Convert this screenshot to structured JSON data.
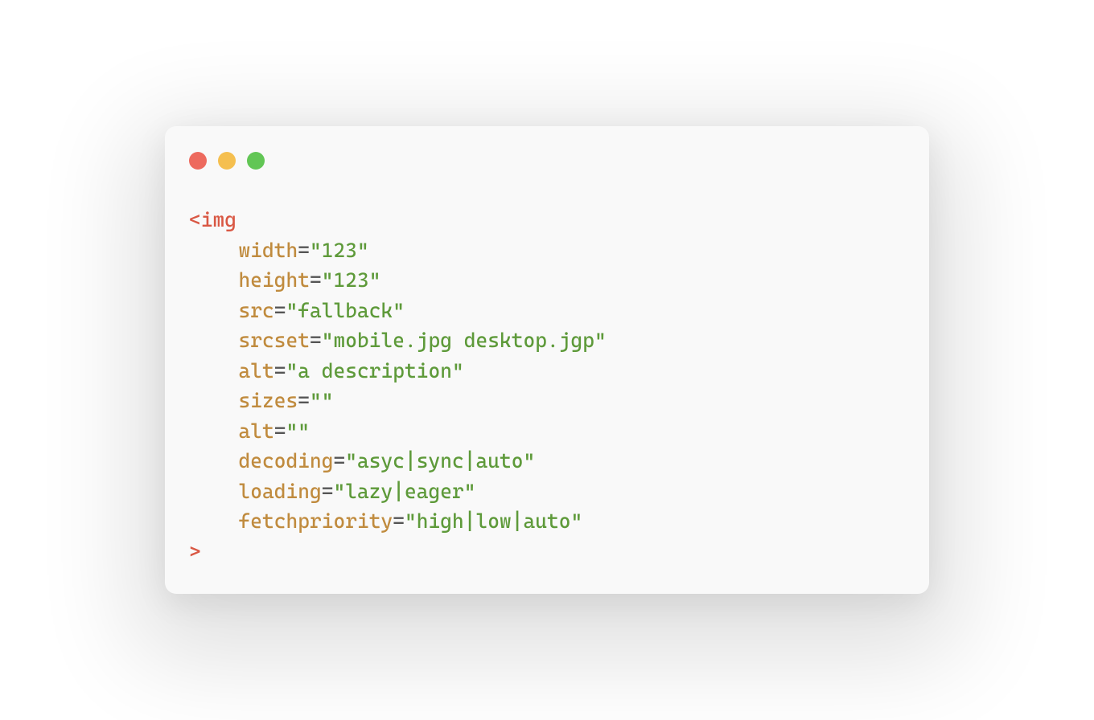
{
  "code": {
    "tag_open": "<img",
    "tag_close": ">",
    "lines": [
      {
        "attr": "width",
        "value": "\"123\""
      },
      {
        "attr": "height",
        "value": "\"123\""
      },
      {
        "attr": "src",
        "value": "\"fallback\""
      },
      {
        "attr": "srcset",
        "value": "\"mobile.jpg desktop.jgp\""
      },
      {
        "attr": "alt",
        "value": "\"a description\""
      },
      {
        "attr": "sizes",
        "value": "\"\""
      },
      {
        "attr": "alt",
        "value": "\"\""
      },
      {
        "attr": "decoding",
        "value": "\"asyc|sync|auto\""
      },
      {
        "attr": "loading",
        "value": "\"lazy|eager\""
      },
      {
        "attr": "fetchpriority",
        "value": "\"high|low|auto\""
      }
    ]
  }
}
